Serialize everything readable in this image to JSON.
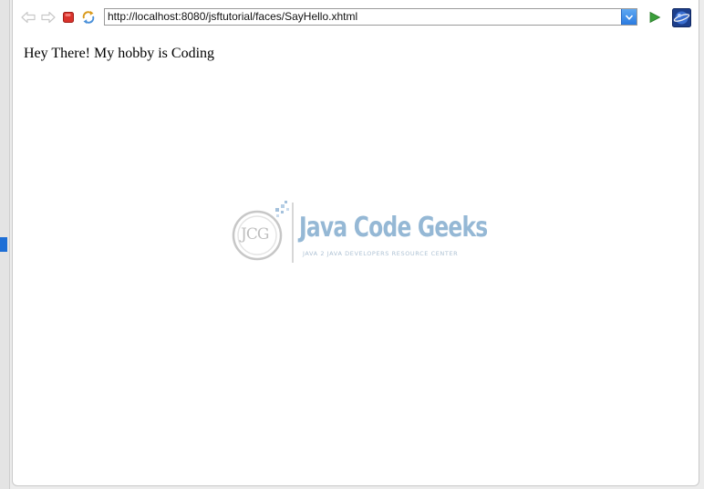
{
  "toolbar": {
    "icons": {
      "back": "back-arrow-icon",
      "forward": "forward-arrow-icon",
      "stop": "stop-icon",
      "refresh": "refresh-icon",
      "dropdown": "chevron-down-icon",
      "go": "play-icon",
      "browser": "eclipse-globe-icon"
    }
  },
  "address_bar": {
    "url": "http://localhost:8080/jsftutorial/faces/SayHello.xhtml"
  },
  "page": {
    "greeting": "Hey There! My hobby is Coding"
  },
  "watermark": {
    "monogram": "JCG",
    "brand": "Java Code Geeks",
    "tagline": "JAVA 2 JAVA DEVELOPERS RESOURCE CENTER"
  },
  "colors": {
    "stop_red": "#d9322b",
    "go_green": "#3a9e3a",
    "accent_blue": "#2b7be0",
    "watermark_blue": "#3f7fb4",
    "watermark_green": "#8bb04a"
  }
}
